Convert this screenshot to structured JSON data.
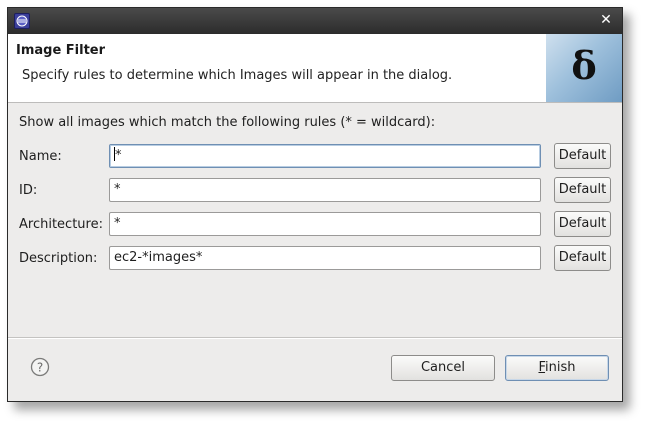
{
  "window": {
    "title": "",
    "close_glyph": "✕"
  },
  "header": {
    "title": "Image Filter",
    "description": "Specify rules to determine which Images will appear in the dialog.",
    "banner_glyph": "δ"
  },
  "form": {
    "intro": "Show all images which match the following rules (* = wildcard):",
    "rows": [
      {
        "label": "Name:",
        "value": "*",
        "button": "Default"
      },
      {
        "label": "ID:",
        "value": "*",
        "button": "Default"
      },
      {
        "label": "Architecture:",
        "value": "*",
        "button": "Default"
      },
      {
        "label": "Description:",
        "value": "ec2-*images*",
        "button": "Default"
      }
    ]
  },
  "footer": {
    "help_glyph": "?",
    "cancel_label": "Cancel",
    "finish_mnemonic": "F",
    "finish_rest": "inish"
  },
  "icons": {
    "app": "eclipse-icon",
    "help": "help-icon",
    "close": "close-icon"
  }
}
